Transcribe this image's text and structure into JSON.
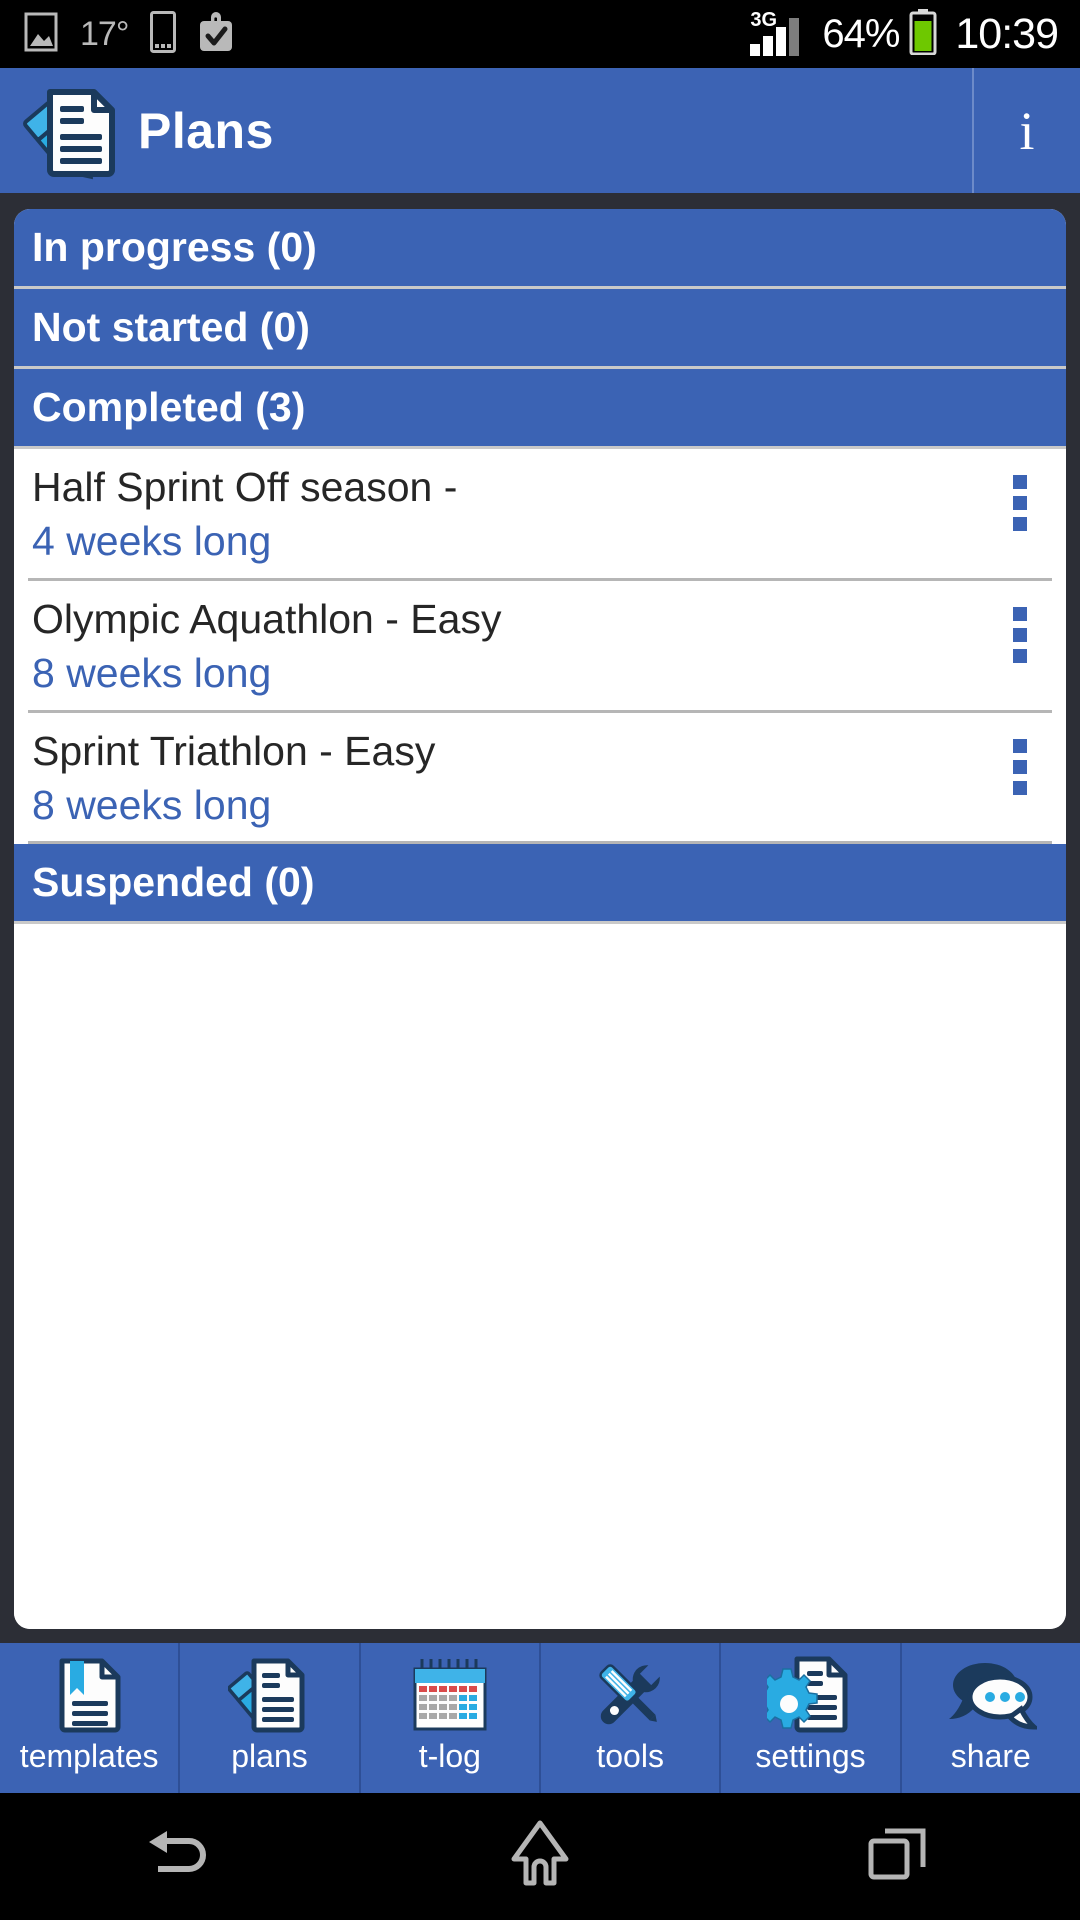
{
  "status_bar": {
    "icons": [
      "gallery-image-icon",
      "sim-card-icon",
      "briefcase-check-icon"
    ],
    "temperature": "17°",
    "network_type": "3G",
    "battery_percent": "64%",
    "clock": "10:39"
  },
  "app_bar": {
    "icon": "plans-document-pencil-icon",
    "title": "Plans",
    "info_glyph": "i"
  },
  "card": {
    "sections": [
      {
        "label": "In progress (0)",
        "name": "in-progress"
      },
      {
        "label": "Not started (0)",
        "name": "not-started"
      },
      {
        "label": "Completed (3)",
        "name": "completed"
      }
    ],
    "plans": [
      {
        "title": "Half Sprint Off season -",
        "duration": "4 weeks long"
      },
      {
        "title": "Olympic Aquathlon - Easy",
        "duration": "8 weeks long"
      },
      {
        "title": "Sprint Triathlon - Easy",
        "duration": "8 weeks long"
      }
    ],
    "suspended_section": {
      "label": "Suspended (0)",
      "name": "suspended"
    },
    "overflow_icon": "three-dots-vertical-icon"
  },
  "tab_bar": {
    "tabs": [
      {
        "label": "templates",
        "icon": "document-bookmark-icon"
      },
      {
        "label": "plans",
        "icon": "document-pencil-icon"
      },
      {
        "label": "t-log",
        "icon": "calendar-icon"
      },
      {
        "label": "tools",
        "icon": "wrench-screwdriver-icon"
      },
      {
        "label": "settings",
        "icon": "gear-document-icon"
      },
      {
        "label": "share",
        "icon": "chat-bubbles-icon"
      }
    ]
  },
  "nav_bar": {
    "buttons": [
      {
        "name": "back-button",
        "icon": "back-arrow-icon"
      },
      {
        "name": "home-button",
        "icon": "home-icon"
      },
      {
        "name": "recents-button",
        "icon": "recents-icon"
      }
    ]
  },
  "colors": {
    "primary_blue": "#3c63b4",
    "section_blue": "#3b63b4",
    "card_white": "#ffffff",
    "backdrop": "#2c2e36",
    "accent_cyan": "#29abe2",
    "icon_navy": "#1b3a5c"
  }
}
